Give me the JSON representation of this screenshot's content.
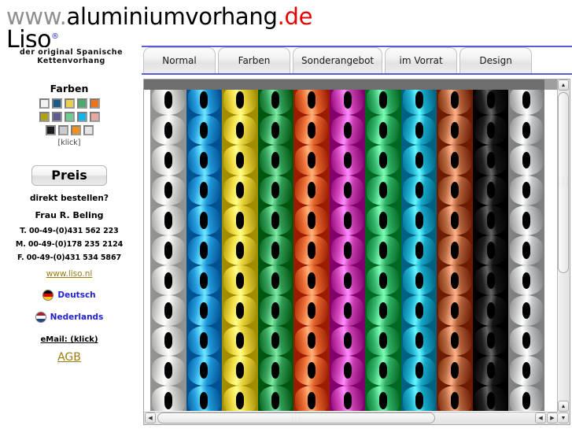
{
  "header": {
    "url_www": "www.",
    "url_main": "aluminiumvorhang",
    "url_tld": ".de",
    "brand_name": "Liso",
    "brand_reg": "®",
    "brand_sub_line1": "der original Spanische",
    "brand_sub_line2": "Kettenvorhang"
  },
  "sidebar": {
    "farben_title": "Farben",
    "klick_label": "[klick]",
    "swatch_rows": [
      [
        {
          "name": "white",
          "hex": "#f2f2f0"
        },
        {
          "name": "blue",
          "hex": "#1b5a86"
        },
        {
          "name": "yellow",
          "hex": "#e9d050"
        },
        {
          "name": "green",
          "hex": "#4aab6d"
        },
        {
          "name": "orange",
          "hex": "#e9751c"
        }
      ],
      [
        {
          "name": "olive",
          "hex": "#b0a11c"
        },
        {
          "name": "violet",
          "hex": "#5f5d8e"
        },
        {
          "name": "mint",
          "hex": "#6dcb92"
        },
        {
          "name": "cyan",
          "hex": "#17b4e8"
        },
        {
          "name": "rose",
          "hex": "#e7a9a4"
        }
      ],
      [
        {
          "name": "black",
          "hex": "#1a1a22"
        },
        {
          "name": "silver",
          "hex": "#c9cdd1"
        },
        {
          "name": "amber",
          "hex": "#f09021"
        },
        {
          "name": "light-grey",
          "hex": "#e4e6e7"
        }
      ]
    ],
    "preis_label": "Preis",
    "order_question": "direkt bestellen?",
    "contact_name": "Frau R. Beling",
    "phone_t": "T. 00-49-(0)431 562 223",
    "phone_m": "M. 00-49-(0)178 235 2124",
    "phone_f": "F. 00-49-(0)431 534 5867",
    "website_label": "www.liso.nl",
    "languages": [
      {
        "label": "Deutsch",
        "flag": "german-flag",
        "stripes": [
          "#000000",
          "#dd0000",
          "#ffce00"
        ]
      },
      {
        "label": "Nederlands",
        "flag": "dutch-flag",
        "stripes": [
          "#ae1c28",
          "#ffffff",
          "#21468b"
        ]
      }
    ],
    "email_label": "eMail: (klick)",
    "agb_label": "AGB"
  },
  "tabs": [
    {
      "label": "Normal",
      "wide": false
    },
    {
      "label": "Farben",
      "wide": false
    },
    {
      "label": "Sonderangebot",
      "wide": true
    },
    {
      "label": "im Vorrat",
      "wide": false
    },
    {
      "label": "Design",
      "wide": false
    }
  ],
  "viewer": {
    "photo_alt": "colored aluminium chain curtain strips",
    "chain_colors": [
      "#d8d8d4",
      "#1f97d8",
      "#e8d23a",
      "#2f9b55",
      "#e2622a",
      "#c83db1",
      "#2fae66",
      "#16a8c8",
      "#b2623a",
      "#141414",
      "#c4c6c8"
    ],
    "scrollbars": {
      "up_arrow": "▲",
      "down_arrow": "▼",
      "left_arrow": "◀",
      "right_arrow": "▶"
    }
  },
  "colors": {
    "tab_border": "#5b5bd6",
    "link_gold": "#9a7d12",
    "lang_blue": "#2222cc",
    "tld_red": "#e60000"
  }
}
